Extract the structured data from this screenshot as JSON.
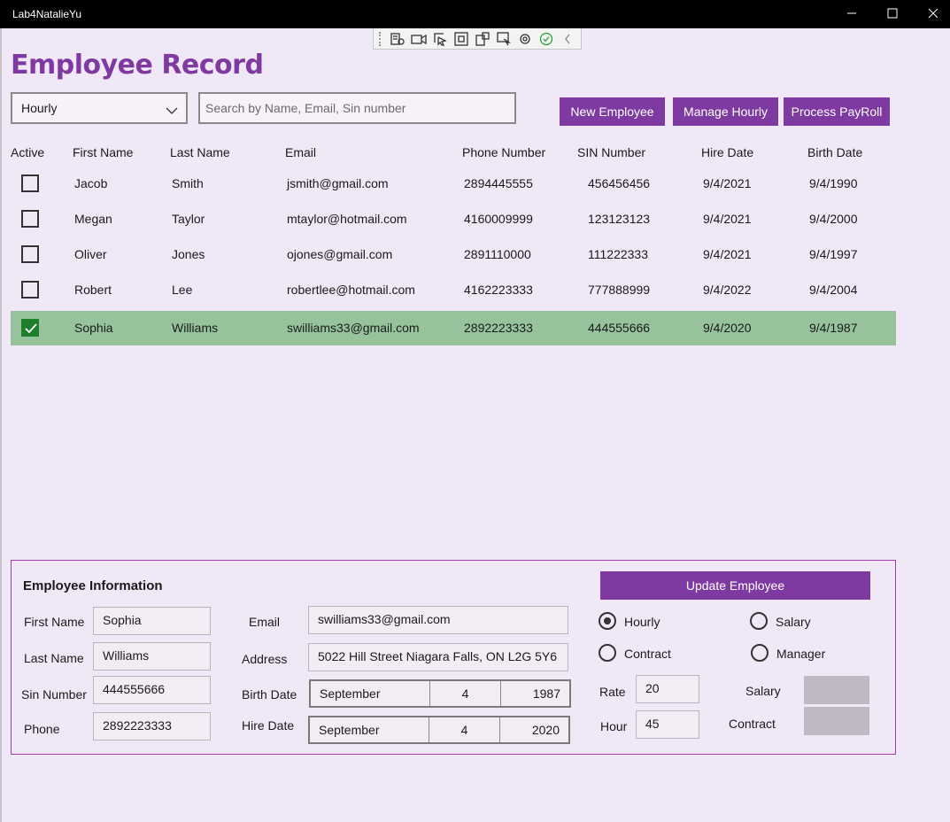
{
  "window": {
    "title": "Lab4NatalieYu"
  },
  "page_title": "Employee Record",
  "filter": {
    "selected": "Hourly"
  },
  "search": {
    "placeholder": "Search by Name, Email, Sin number"
  },
  "actions": {
    "new_employee": "New Employee",
    "manage_hourly": "Manage Hourly",
    "process_payroll": "Process PayRoll"
  },
  "table": {
    "headers": [
      "Active",
      "First Name",
      "Last Name",
      "Email",
      "Phone Number",
      "SIN Number",
      "Hire Date",
      "Birth Date"
    ],
    "rows": [
      {
        "active": false,
        "first": "Jacob",
        "last": "Smith",
        "email": "jsmith@gmail.com",
        "phone": "2894445555",
        "sin": "456456456",
        "hire": "9/4/2021",
        "birth": "9/4/1990"
      },
      {
        "active": false,
        "first": "Megan",
        "last": "Taylor",
        "email": "mtaylor@hotmail.com",
        "phone": "4160009999",
        "sin": "123123123",
        "hire": "9/4/2021",
        "birth": "9/4/2000"
      },
      {
        "active": false,
        "first": "Oliver",
        "last": "Jones",
        "email": "ojones@gmail.com",
        "phone": "2891110000",
        "sin": "111222333",
        "hire": "9/4/2021",
        "birth": "9/4/1997"
      },
      {
        "active": false,
        "first": "Robert",
        "last": "Lee",
        "email": "robertlee@hotmail.com",
        "phone": "4162223333",
        "sin": "777888999",
        "hire": "9/4/2022",
        "birth": "9/4/2004"
      },
      {
        "active": true,
        "first": "Sophia",
        "last": "Williams",
        "email": "swilliams33@gmail.com",
        "phone": "2892223333",
        "sin": "444555666",
        "hire": "9/4/2020",
        "birth": "9/4/1987"
      }
    ]
  },
  "info": {
    "heading": "Employee Information",
    "labels": {
      "first_name": "First Name",
      "last_name": "Last Name",
      "sin_number": "Sin Number",
      "phone": "Phone",
      "email": "Email",
      "address": "Address",
      "birth_date": "Birth Date",
      "hire_date": "Hire Date",
      "rate": "Rate",
      "hour": "Hour",
      "salary": "Salary",
      "contract": "Contract"
    },
    "values": {
      "first_name": "Sophia",
      "last_name": "Williams",
      "sin_number": "444555666",
      "phone": "2892223333",
      "email": "swilliams33@gmail.com",
      "address": "5022 Hill Street Niagara Falls, ON L2G 5Y6",
      "rate": "20",
      "hour": "45"
    },
    "birth_date": {
      "month": "September",
      "day": "4",
      "year": "1987"
    },
    "hire_date": {
      "month": "September",
      "day": "4",
      "year": "2020"
    },
    "update_button": "Update Employee",
    "types": {
      "hourly": "Hourly",
      "salary": "Salary",
      "contract": "Contract",
      "manager": "Manager",
      "selected": "hourly"
    }
  }
}
